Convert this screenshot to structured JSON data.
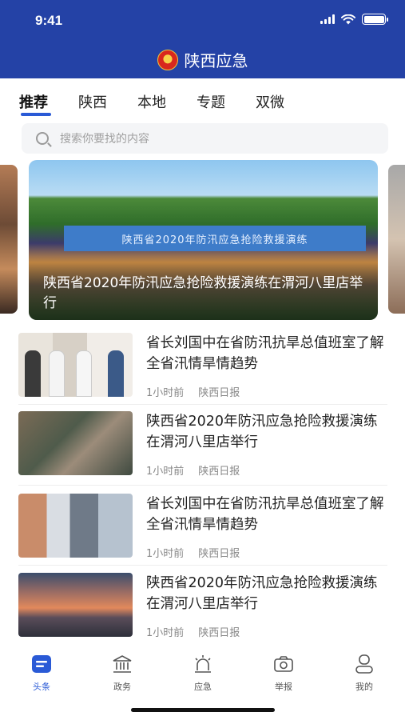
{
  "status": {
    "time": "9:41"
  },
  "app": {
    "title": "陕西应急"
  },
  "tabs": [
    {
      "label": "推荐"
    },
    {
      "label": "陕西"
    },
    {
      "label": "本地"
    },
    {
      "label": "专题"
    },
    {
      "label": "双微"
    }
  ],
  "search": {
    "placeholder": "搜索你要找的内容"
  },
  "banner": {
    "sign": "陕西省2020年防汛应急抢险救援演练",
    "caption": "陕西省2020年防汛应急抢险救援演练在渭河八里店举行"
  },
  "news": [
    {
      "title": "省长刘国中在省防汛抗旱总值班室了解全省汛情旱情趋势",
      "time": "1小时前",
      "source": "陕西日报"
    },
    {
      "title": "陕西省2020年防汛应急抢险救援演练在渭河八里店举行",
      "time": "1小时前",
      "source": "陕西日报"
    },
    {
      "title": "省长刘国中在省防汛抗旱总值班室了解全省汛情旱情趋势",
      "time": "1小时前",
      "source": "陕西日报"
    },
    {
      "title": "陕西省2020年防汛应急抢险救援演练在渭河八里店举行",
      "time": "1小时前",
      "source": "陕西日报"
    }
  ],
  "tabbar": [
    {
      "label": "头条",
      "icon": "headline-icon"
    },
    {
      "label": "政务",
      "icon": "government-building-icon"
    },
    {
      "label": "应急",
      "icon": "alarm-light-icon"
    },
    {
      "label": "举报",
      "icon": "camera-icon"
    },
    {
      "label": "我的",
      "icon": "user-icon"
    }
  ],
  "colors": {
    "brand": "#2442a6",
    "accent": "#2a5ad6"
  }
}
